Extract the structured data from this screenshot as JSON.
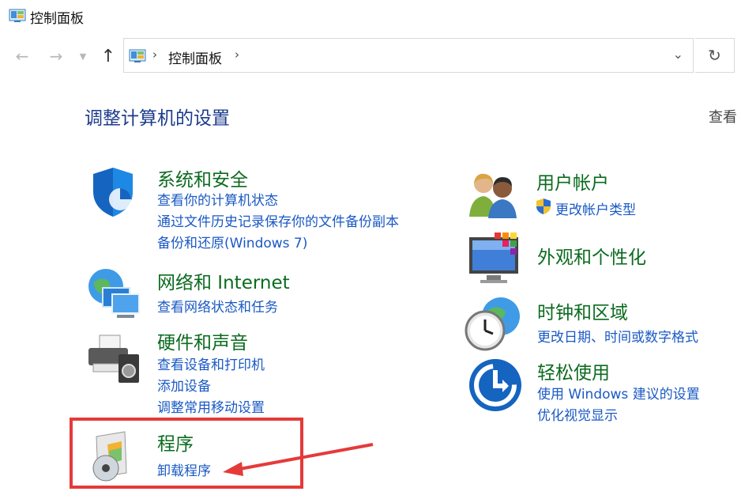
{
  "window": {
    "title": "控制面板"
  },
  "nav": {
    "back_icon": "arrow-left-icon",
    "forward_icon": "arrow-right-icon",
    "recent_icon": "chevron-down-icon",
    "up_icon": "arrow-up-icon",
    "breadcrumb": "控制面板",
    "refresh_icon": "refresh-icon"
  },
  "main": {
    "heading": "调整计算机的设置",
    "view_by": "查看"
  },
  "categories": {
    "system": {
      "title": "系统和安全",
      "links": [
        "查看你的计算机状态",
        "通过文件历史记录保存你的文件备份副本",
        "备份和还原(Windows 7)"
      ]
    },
    "network": {
      "title": "网络和 Internet",
      "links": [
        "查看网络状态和任务"
      ]
    },
    "hardware": {
      "title": "硬件和声音",
      "links": [
        "查看设备和打印机",
        "添加设备",
        "调整常用移动设置"
      ]
    },
    "programs": {
      "title": "程序",
      "links": [
        "卸载程序"
      ]
    },
    "users": {
      "title": "用户帐户",
      "links": [
        "更改帐户类型"
      ]
    },
    "appearance": {
      "title": "外观和个性化",
      "links": []
    },
    "clock": {
      "title": "时钟和区域",
      "links": [
        "更改日期、时间或数字格式"
      ]
    },
    "ease": {
      "title": "轻松使用",
      "links": [
        "使用 Windows 建议的设置",
        "优化视觉显示"
      ]
    }
  },
  "colors": {
    "heading": "#1c3b8c",
    "category_title": "#0b6b1f",
    "link": "#1a59c4",
    "highlight": "#e53a3a"
  }
}
